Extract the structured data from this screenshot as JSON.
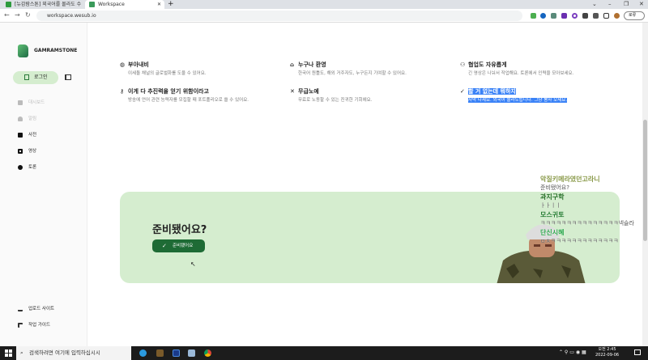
{
  "browser": {
    "tabs": [
      {
        "label": "[뉴감람스톤] 외국어를 몰라도 수"
      },
      {
        "label": "Workspace"
      }
    ],
    "url": "workspace.wesub.io",
    "profile_label": "로류"
  },
  "sidebar": {
    "brand": "GAMRAMSTONE",
    "login": "로그인",
    "items": [
      {
        "label": "대시보드"
      },
      {
        "label": "알림"
      },
      {
        "label": "사전"
      },
      {
        "label": "영상"
      },
      {
        "label": "토론"
      }
    ],
    "bottom": [
      {
        "label": "업로드 사이트"
      },
      {
        "label": "작업 가이드"
      }
    ]
  },
  "features": [
    {
      "title": "부아내비",
      "desc": "이세돌 채널의 글로벌화를 도울 수 있어요."
    },
    {
      "title": "누구나 환영",
      "desc": "한국어 원틀도, 해외 거주자도, 누구든지 기여할 수 있어요."
    },
    {
      "title": "협업도 자유롭게",
      "desc": "긴 영상은 나눠서 작업해요. 토론에서 인력을 모아보세요."
    },
    {
      "title": "이게 다 추진력을 얻기 위함이라고",
      "desc": "방송에 언어 관련 능력자를 모집할 때 포트폴리오로 쓸 수 있어요."
    },
    {
      "title": "무급노예",
      "desc": "무료로 노동할 수 있는 진귀한 기회에요."
    },
    {
      "title": "할 거 없는데 뭐하지",
      "desc": "자막 다세요. 외국어 몰라도됩니다. 그냥 봉사 오세요."
    }
  ],
  "cta": {
    "title": "준비됐어요?",
    "button": "준비됐어요"
  },
  "chat": [
    {
      "name": "악질키메라였던고라니",
      "msg": "준비됐어요?",
      "color": "#8a9a4a"
    },
    {
      "name": "과지구학",
      "msg": "ㅏㅏㅣㅣ",
      "color": "#1a6a1a"
    },
    {
      "name": "모스귀토",
      "msg": "ㅋㅋㅋㅋㅋㅋㅋㅋㅋㅋㅋㅋㅋㅋㅋ넥슬라",
      "color": "#1e7a2a"
    },
    {
      "name": "단신시혜",
      "msg": "ㅁㅊㅋㅋㅋㅋㅋㅋㅋㅋㅋㅋㅋㅋㅋ",
      "color": "#2aa84a"
    }
  ],
  "taskbar": {
    "search_placeholder": "검색하려면 여기에 입력하십시시",
    "time": "오전 2:45",
    "date": "2022-09-06"
  }
}
